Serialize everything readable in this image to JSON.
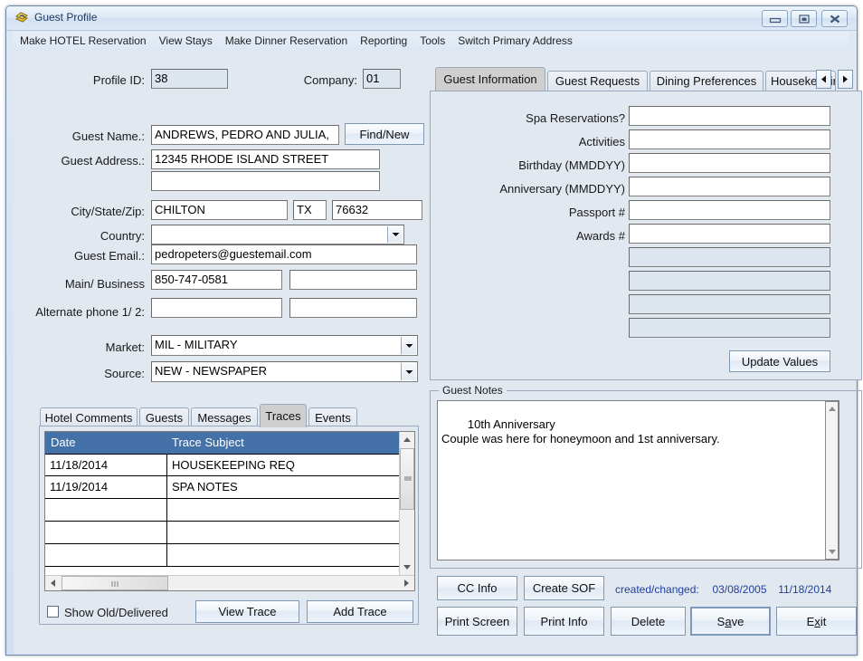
{
  "window": {
    "title": "Guest Profile",
    "icon": "app-icon",
    "buttons": {
      "minimize": "minimize-icon",
      "maximize": "maximize-icon",
      "close": "close-icon"
    }
  },
  "menubar": {
    "items": [
      "Make HOTEL Reservation",
      "View Stays",
      "Make Dinner Reservation",
      "Reporting",
      "Tools",
      "Switch Primary Address"
    ]
  },
  "header": {
    "profile_id_label": "Profile ID:",
    "profile_id_value": "38",
    "company_label": "Company:",
    "company_value": "01"
  },
  "guest_form": {
    "name_label": "Guest Name.:",
    "name_value": "ANDREWS, PEDRO AND JULIA,",
    "find_new_label": "Find/New",
    "address_label": "Guest Address.:",
    "address_line1": "12345 RHODE ISLAND STREET",
    "address_line2": "",
    "city_state_zip_label": "City/State/Zip:",
    "city_value": "CHILTON",
    "state_value": "TX",
    "zip_value": "76632",
    "country_label": "Country:",
    "country_value": "",
    "email_label": "Guest Email.:",
    "email_value": "pedropeters@guestemail.com",
    "main_business_label": "Main/ Business",
    "main_phone_value": "850-747-0581",
    "business_phone_value": "",
    "alternate_label": "Alternate phone 1/ 2:",
    "alternate_1_value": "",
    "alternate_2_value": "",
    "market_label": "Market:",
    "market_value": "MIL  - MILITARY",
    "source_label": "Source:",
    "source_value": "NEW  - NEWSPAPER"
  },
  "right_panel": {
    "tabs": [
      {
        "label": "Guest Information",
        "active": true
      },
      {
        "label": "Guest Requests",
        "active": false
      },
      {
        "label": "Dining Preferences",
        "active": false
      },
      {
        "label": "Housekeepin",
        "active": false
      }
    ],
    "nav_prev": "arrow-left-icon",
    "nav_next": "arrow-right-icon",
    "fields": [
      {
        "label": "Spa Reservations?",
        "value": "",
        "disabled": false
      },
      {
        "label": "Activities",
        "value": "",
        "disabled": false
      },
      {
        "label": "Birthday (MMDDYY)",
        "value": "",
        "disabled": false
      },
      {
        "label": "Anniversary (MMDDYY)",
        "value": "",
        "disabled": false
      },
      {
        "label": "Passport #",
        "value": "",
        "disabled": false
      },
      {
        "label": "Awards #",
        "value": "",
        "disabled": false
      },
      {
        "label": "",
        "value": "",
        "disabled": true
      },
      {
        "label": "",
        "value": "",
        "disabled": true
      },
      {
        "label": "",
        "value": "",
        "disabled": true
      },
      {
        "label": "",
        "value": "",
        "disabled": true
      }
    ],
    "update_values_label": "Update Values"
  },
  "traces_panel": {
    "tabs": [
      {
        "label": "Hotel Comments",
        "active": false
      },
      {
        "label": "Guests",
        "active": false
      },
      {
        "label": "Messages",
        "active": false
      },
      {
        "label": "Traces",
        "active": true
      },
      {
        "label": "Events",
        "active": false
      }
    ],
    "columns": [
      "Date",
      "Trace Subject"
    ],
    "rows": [
      {
        "date": "11/18/2014",
        "subject": "HOUSEKEEPING REQ"
      },
      {
        "date": "11/19/2014",
        "subject": "SPA NOTES"
      },
      {
        "date": "",
        "subject": ""
      },
      {
        "date": "",
        "subject": ""
      },
      {
        "date": "",
        "subject": ""
      }
    ],
    "show_old_label": "Show Old/Delivered",
    "show_old_checked": false,
    "view_trace_label": "View Trace",
    "add_trace_label": "Add Trace"
  },
  "notes": {
    "group_title": "Guest Notes",
    "text": "10th Anniversary\nCouple was here for honeymoon and 1st anniversary."
  },
  "actions": {
    "cc_info": "CC Info",
    "create_sof": "Create SOF",
    "created_changed_label": "created/changed:",
    "created_date": "03/08/2005",
    "changed_date": "11/18/2014",
    "print_screen": "Print Screen",
    "print_info": "Print Info",
    "delete": "Delete",
    "save": "Save",
    "exit": "Exit"
  },
  "colors": {
    "window_bg": "#e2e8f0",
    "grid_header": "#4472a8",
    "title_text": "#17365d",
    "created_text": "#1f3f9e",
    "active_tab": "#cfcfcf"
  }
}
